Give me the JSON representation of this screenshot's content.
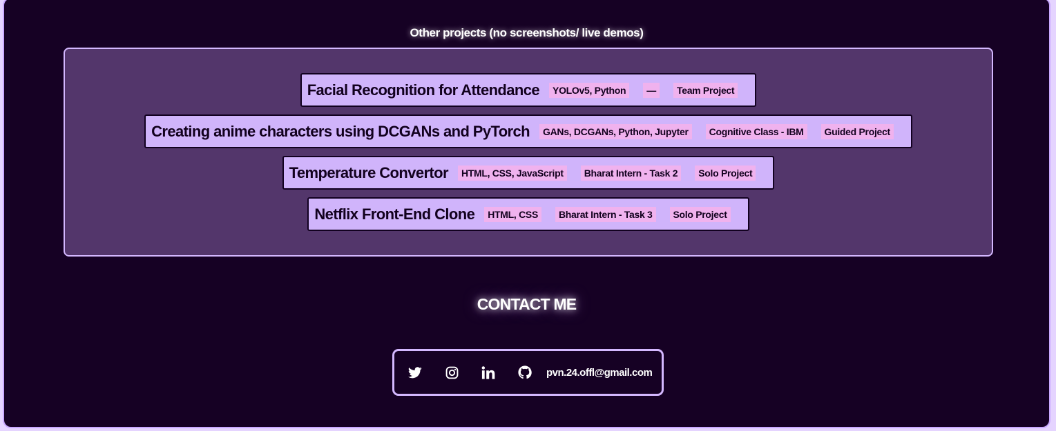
{
  "other_projects": {
    "title": "Other projects (no screenshots/ live demos)",
    "projects": [
      {
        "name": "Facial Recognition for Attendance",
        "tags": [
          "YOLOv5, Python",
          "—",
          "Team Project"
        ]
      },
      {
        "name": "Creating anime characters using DCGANs and PyTorch",
        "tags": [
          "GANs, DCGANs, Python, Jupyter",
          "Cognitive Class - IBM",
          "Guided Project"
        ]
      },
      {
        "name": "Temperature Convertor",
        "tags": [
          "HTML, CSS, JavaScript",
          "Bharat Intern - Task 2",
          "Solo Project"
        ]
      },
      {
        "name": "Netflix Front-End Clone",
        "tags": [
          "HTML, CSS",
          "Bharat Intern - Task 3",
          "Solo Project"
        ]
      }
    ]
  },
  "contact": {
    "title": "CONTACT ME",
    "icons": [
      "twitter-icon",
      "instagram-icon",
      "linkedin-icon",
      "github-icon"
    ],
    "email": "pvn.24.offl@gmail.com"
  },
  "colors": {
    "background": "#160124",
    "panel": "#53366b",
    "card": "#d0b4fb",
    "tag": "#f0b2ee",
    "border_accent": "#d4b8ff",
    "text_light": "#ffffff",
    "text_dark": "#12011e"
  }
}
